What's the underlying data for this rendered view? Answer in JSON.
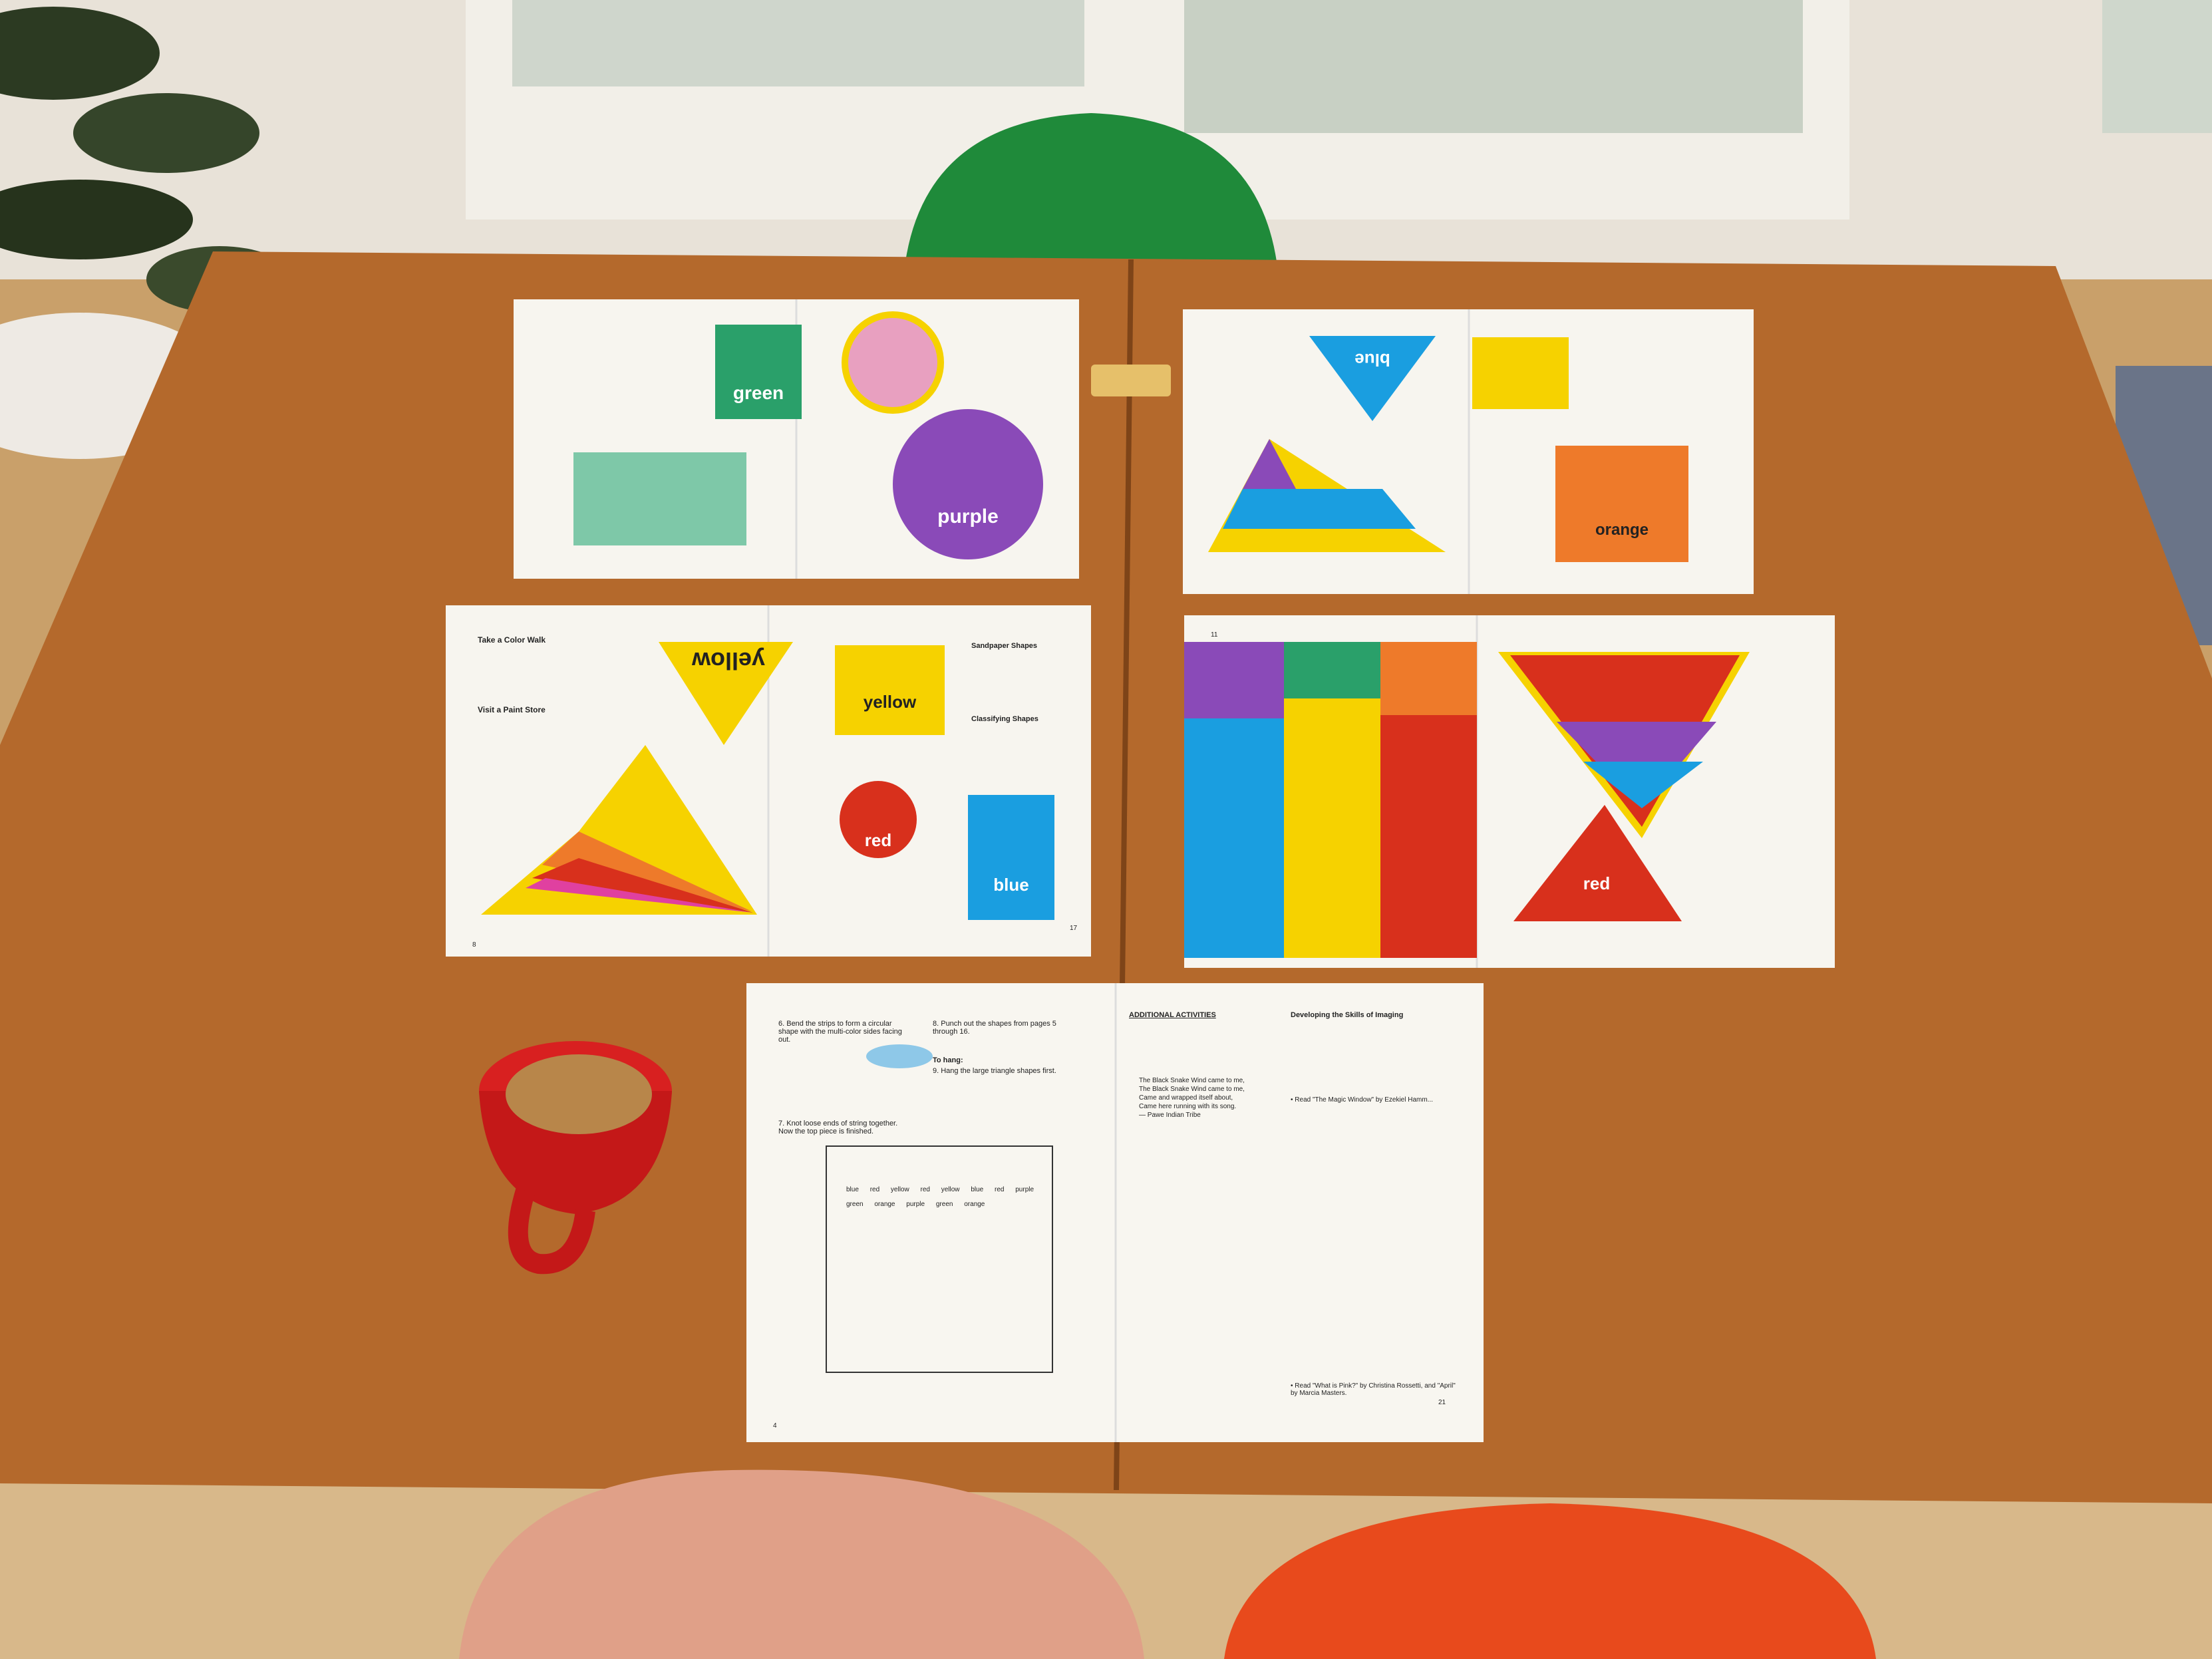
{
  "colors": {
    "wood": "#b8692c",
    "yellow": "#f6d200",
    "red": "#d8301c",
    "blue": "#1a9ee0",
    "green": "#2aa06a",
    "purple": "#8a4ab8",
    "orange": "#ee7a2a",
    "chair_green": "#1f8a3a",
    "chair_orange": "#e84a1c",
    "chair_pink": "#e0a088",
    "mug": "#d82020"
  },
  "booklets": {
    "top_left": {
      "label_green": "green",
      "label_purple": "purple"
    },
    "top_right": {
      "label_blue": "blue",
      "label_orange": "orange"
    },
    "mid_left": {
      "label_yellow_tri": "yellow",
      "label_yellow_sq": "yellow",
      "label_red": "red",
      "label_blue": "blue",
      "heading_1": "Take a Color Walk",
      "heading_2": "Visit a Paint Store",
      "heading_3": "Sandpaper Shapes",
      "heading_4": "Classifying Shapes",
      "page_left": "8",
      "page_right": "17"
    },
    "mid_right": {
      "label_red": "red",
      "page_left": "11"
    },
    "bottom": {
      "heading_activities": "ADDITIONAL ACTIVITIES",
      "heading_imaging": "Developing the Skills of Imaging",
      "step_6": "6. Bend the strips to form a circular shape with the multi-color sides facing out.",
      "step_7": "7. Knot loose ends of string together. Now the top piece is finished.",
      "step_8": "8. Punch out the shapes from pages 5 through 16.",
      "to_hang": "To hang:",
      "step_9": "9. Hang the large triangle shapes first.",
      "poem_1": "The Black Snake Wind came to me,",
      "poem_2": "The Black Snake Wind came to me,",
      "poem_3": "Came and wrapped itself about,",
      "poem_4": "Came here running with its song.",
      "poem_credit": "— Pawe Indian Tribe",
      "read_1": "• Read \"The Magic Window\" by Ezekiel Hamm...",
      "read_2": "• Read \"What is Pink?\" by Christina Rossetti, and \"April\" by Marcia Masters.",
      "page_left": "4",
      "page_right": "21",
      "mobile_labels": [
        "blue",
        "red",
        "yellow",
        "red",
        "yellow",
        "blue",
        "red",
        "purple",
        "green",
        "orange",
        "purple",
        "green",
        "orange"
      ]
    }
  }
}
